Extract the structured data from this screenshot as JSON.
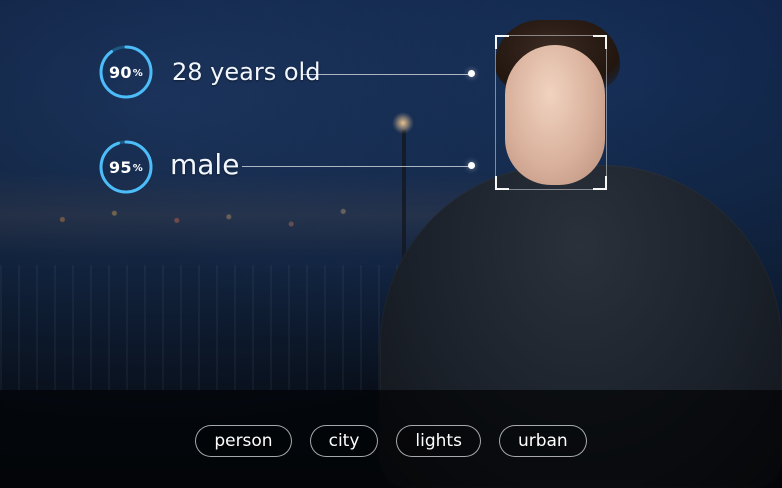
{
  "overlay": {
    "age": {
      "confidence_value": 90,
      "confidence_text": "90",
      "confidence_unit": "%",
      "label": "28 years old"
    },
    "gender": {
      "confidence_value": 95,
      "confidence_text": "95",
      "confidence_unit": "%",
      "label": "male"
    }
  },
  "tags": [
    {
      "label": "person"
    },
    {
      "label": "city"
    },
    {
      "label": "lights"
    },
    {
      "label": "urban"
    }
  ],
  "colors": {
    "ring_track": "#1d5f8a",
    "ring_fill": "#4fc3ff",
    "text": "#f2f7ff"
  }
}
